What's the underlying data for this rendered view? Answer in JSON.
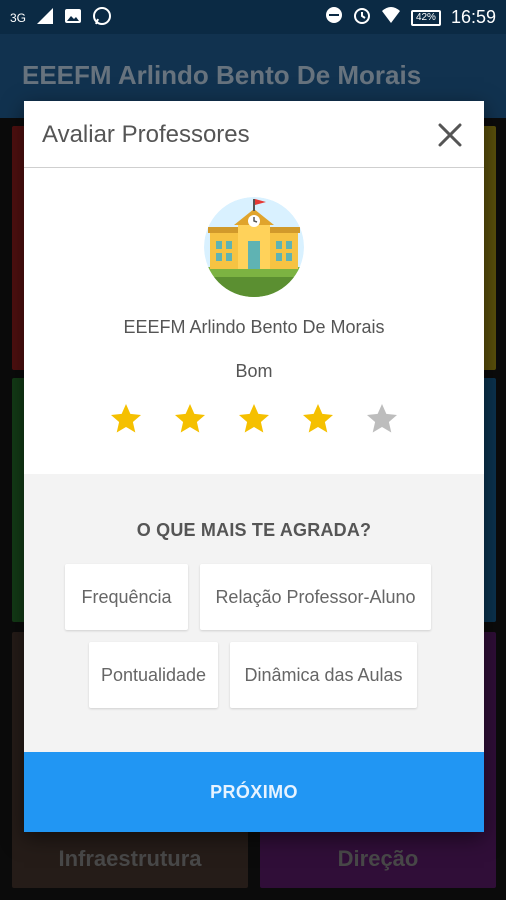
{
  "status_bar": {
    "network": "3G",
    "battery": "42%",
    "time": "16:59"
  },
  "app_bar": {
    "title": "EEEFM Arlindo Bento De Morais"
  },
  "tiles": {
    "bottom_left": "Infraestrutura",
    "bottom_right": "Direção"
  },
  "dialog": {
    "title": "Avaliar Professores",
    "school_name": "EEEFM Arlindo Bento De Morais",
    "rating_label": "Bom",
    "rating": {
      "value": 4,
      "max": 5
    },
    "question": "O QUE MAIS TE AGRADA?",
    "options": [
      "Frequência",
      "Relação Professor-Aluno",
      "Pontualidade",
      "Dinâmica das Aulas"
    ],
    "next_button": "PRÓXIMO"
  },
  "colors": {
    "accent": "#2196f3",
    "star_filled": "#f5c000",
    "star_empty": "#bdbdbd"
  },
  "icons": [
    "signal-icon",
    "image-icon",
    "whatsapp-icon",
    "dnd-icon",
    "alarm-icon",
    "wifi-icon",
    "battery-icon",
    "close-icon",
    "star-icon",
    "school-icon"
  ]
}
